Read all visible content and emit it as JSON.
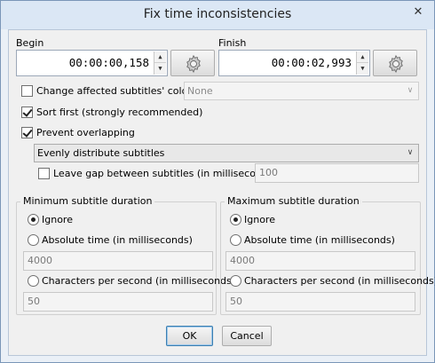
{
  "window": {
    "title": "Fix time inconsistencies",
    "close_glyph": "✕"
  },
  "begin": {
    "label": "Begin",
    "value": "00:00:00,158"
  },
  "finish": {
    "label": "Finish",
    "value": "00:00:02,993"
  },
  "options": {
    "change_color_label": "Change affected subtitles' color",
    "change_color_checked": false,
    "color_select_value": "None",
    "sort_first_label": "Sort first  (strongly recommended)",
    "sort_first_checked": true,
    "prevent_overlap_label": "Prevent overlapping",
    "prevent_overlap_checked": true,
    "overlap_mode_value": "Evenly distribute subtitles",
    "leave_gap_label": "Leave gap between subtitles (in milliseconds)",
    "leave_gap_checked": false,
    "gap_value": "100"
  },
  "min_group": {
    "title": "Minimum subtitle duration",
    "ignore_label": "Ignore",
    "absolute_label": "Absolute time  (in milliseconds)",
    "absolute_value": "4000",
    "cps_label": "Characters per second  (in milliseconds)",
    "cps_value": "50",
    "selected": "ignore"
  },
  "max_group": {
    "title": "Maximum subtitle duration",
    "ignore_label": "Ignore",
    "absolute_label": "Absolute time  (in milliseconds)",
    "absolute_value": "4000",
    "cps_label": "Characters per second  (in milliseconds)",
    "cps_value": "50",
    "selected": "ignore"
  },
  "buttons": {
    "ok": "OK",
    "cancel": "Cancel"
  },
  "icons": {
    "gear": "gear-icon",
    "spin_up": "▲",
    "spin_down": "▼",
    "dropdown": "∨"
  }
}
